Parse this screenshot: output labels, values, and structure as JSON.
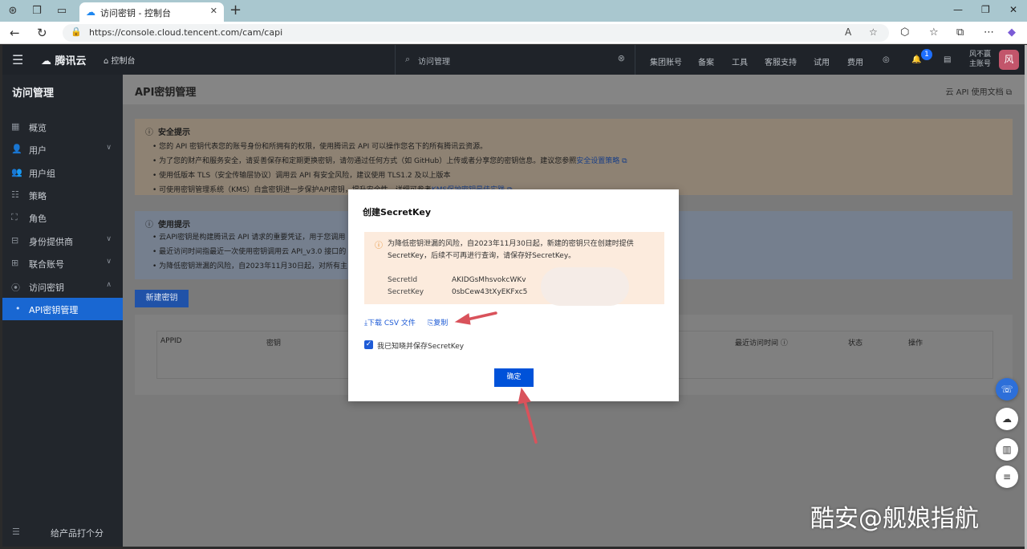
{
  "browser": {
    "tab_title": "访问密钥 - 控制台",
    "url": "https://console.cloud.tencent.com/cam/capi"
  },
  "header": {
    "brand": "腾讯云",
    "console": "控制台",
    "search_placeholder": "访问管理",
    "nav": [
      "集团账号",
      "备案",
      "工具",
      "客服支持",
      "试用",
      "费用"
    ],
    "bell_count": "1",
    "user_line1": "风不赢",
    "user_line2": "主账号",
    "avatar": "风"
  },
  "sidebar": {
    "title": "访问管理",
    "items": [
      {
        "label": "概览",
        "icon": "grid-icon"
      },
      {
        "label": "用户",
        "icon": "user-icon"
      },
      {
        "label": "用户组",
        "icon": "users-icon"
      },
      {
        "label": "策略",
        "icon": "policy-icon"
      },
      {
        "label": "角色",
        "icon": "role-icon"
      },
      {
        "label": "身份提供商",
        "icon": "idp-icon"
      },
      {
        "label": "联合账号",
        "icon": "link-icon"
      },
      {
        "label": "访问密钥",
        "icon": "key-icon"
      },
      {
        "label": "API密钥管理",
        "icon": "dot-icon"
      }
    ],
    "footer": "给产品打个分"
  },
  "main": {
    "title": "API密钥管理",
    "doc_link": "云 API 使用文档",
    "security": {
      "title": "安全提示",
      "lines": [
        "您的 API 密钥代表您的账号身份和所拥有的权限，使用腾讯云 API 可以操作您名下的所有腾讯云资源。",
        "为了您的财产和服务安全，请妥善保存和定期更换密钥，请勿通过任何方式（如 GitHub）上传或者分享您的密钥信息。建议您参照",
        "使用低版本 TLS（安全传输层协议）调用云 API 有安全风险，建议使用 TLS1.2 及以上版本",
        "可使用密钥管理系统（KMS）白盒密钥进一步保护API密钥，提升安全性，详细可参考"
      ],
      "link1": "安全设置策略",
      "link2": "KMS保护密钥最佳实践"
    },
    "usage": {
      "title": "使用提示",
      "lines": [
        "云API密钥是构建腾讯云 API 请求的重要凭证，用于您调用",
        "最近访问时间指最近一次使用密钥调用云 API_v3.0 接口的",
        "为降低密钥泄漏的风险，自2023年11月30日起，对所有主"
      ]
    },
    "new_button": "新建密钥",
    "columns": [
      "APPID",
      "密钥",
      "最近访问时间",
      "状态",
      "操作"
    ]
  },
  "modal": {
    "title": "创建SecretKey",
    "warning": "为降低密钥泄漏的风险，自2023年11月30日起，新建的密钥只在创建时提供SecretKey，后续不可再进行查询，请保存好SecretKey。",
    "secret_id_label": "SecretId",
    "secret_id_value": "AKIDGsMhsvokcWKv",
    "secret_key_label": "SecretKey",
    "secret_key_value": "0sbCew43tXyEKFxc5",
    "download": "下载 CSV 文件",
    "copy": "复制",
    "ack": "我已知晓并保存SecretKey",
    "ok": "确定"
  },
  "watermark": "酷安@舰娘指航"
}
